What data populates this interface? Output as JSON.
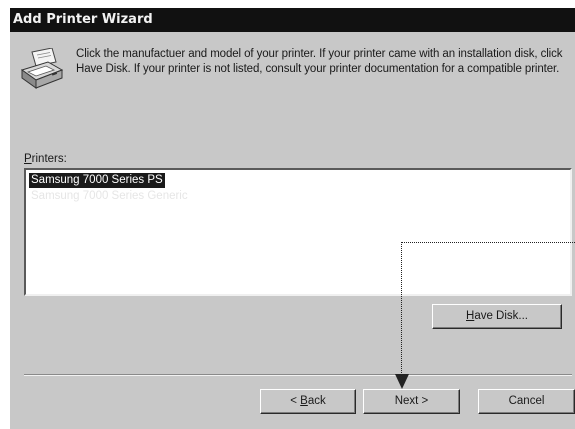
{
  "window": {
    "title": "Add Printer Wizard"
  },
  "intro": {
    "text": "Click the manufactuer and model of your printer. If your printer came with an installation disk, click Have Disk. If your printer is not listed, consult your printer documentation for a compatible printer."
  },
  "printers": {
    "label_accel": "P",
    "label_rest": "rinters:",
    "items": [
      {
        "label": "Samsung 7000 Series PS",
        "selected": true
      },
      {
        "label": "Samsung 7000 Series Generic",
        "selected": false
      }
    ]
  },
  "buttons": {
    "have_disk": {
      "accel": "H",
      "rest": "ave Disk..."
    },
    "back": {
      "prefix": "< ",
      "accel": "B",
      "rest": "ack"
    },
    "next": "Next >",
    "cancel": "Cancel"
  },
  "icons": {
    "printer": "printer-icon",
    "guide_arrow": "arrow-down-icon"
  },
  "colors": {
    "title_bar": "#111111",
    "dialog_face": "#c8c8c8",
    "selection": "#1a1a1a"
  }
}
